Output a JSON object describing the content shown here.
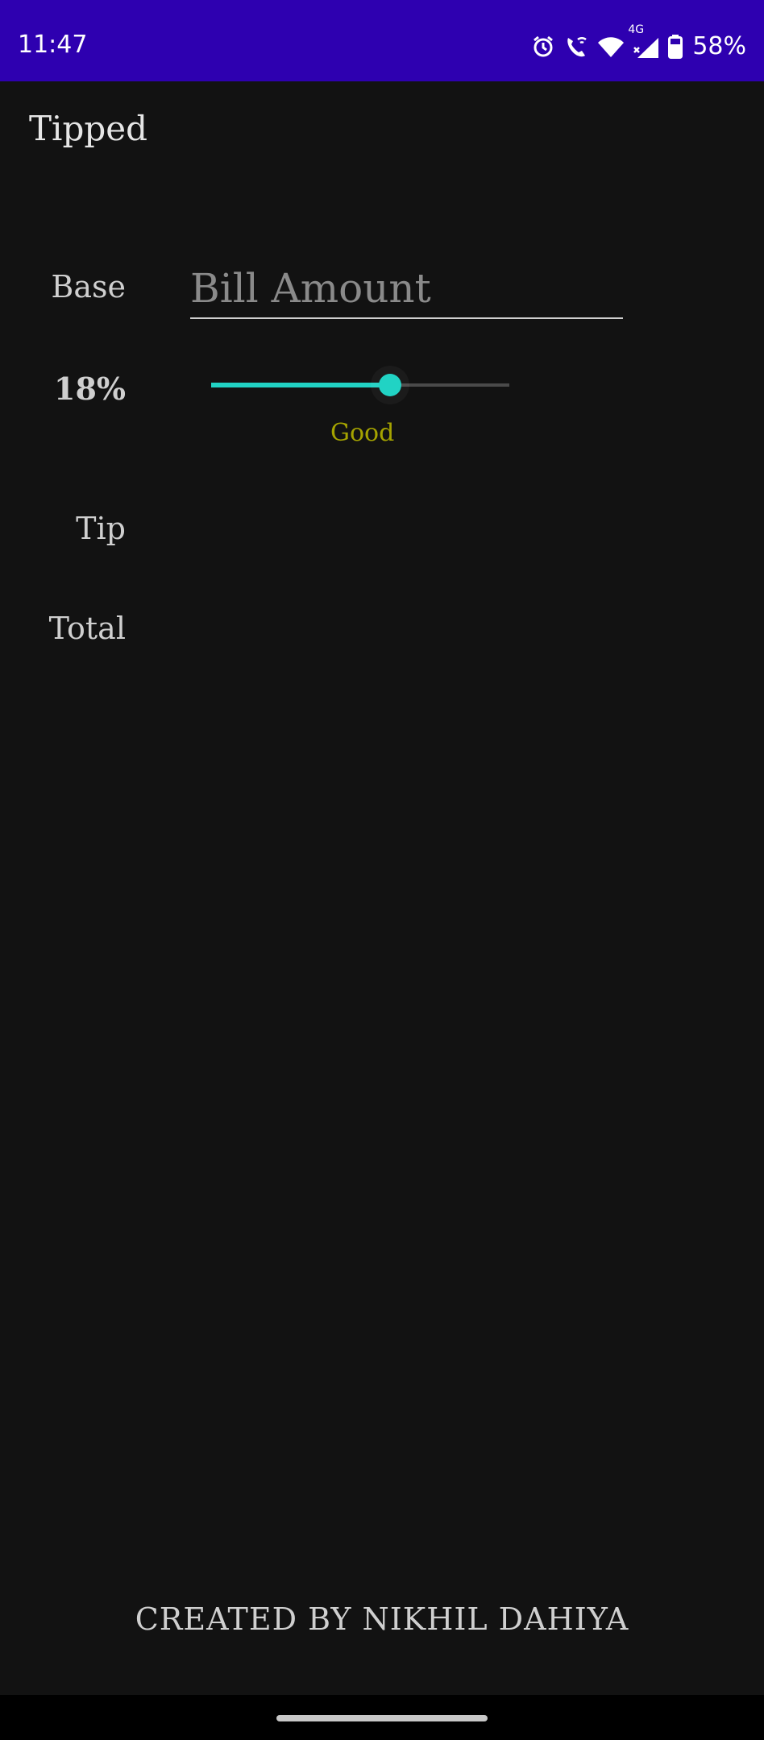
{
  "status_bar": {
    "time": "11:47",
    "icons": [
      "alarm-icon",
      "wifi-call-icon",
      "wifi-icon",
      "signal-4g-icon",
      "battery-icon"
    ],
    "network_type": "4G",
    "battery": "58%",
    "color": "#2e00b0"
  },
  "app": {
    "title": "Tipped"
  },
  "form": {
    "base_label": "Base",
    "bill_placeholder": "Bill Amount",
    "bill_value": "",
    "percent_label": "18%",
    "tip_percent": 18,
    "slider_fraction": 0.6,
    "tip_rating": "Good",
    "tip_label": "Tip",
    "tip_value": "",
    "total_label": "Total",
    "total_value": "",
    "accent_color": "#21d3c4",
    "rating_color": "#a5a300"
  },
  "footer": {
    "credit": "CREATED BY NIKHIL DAHIYA"
  }
}
